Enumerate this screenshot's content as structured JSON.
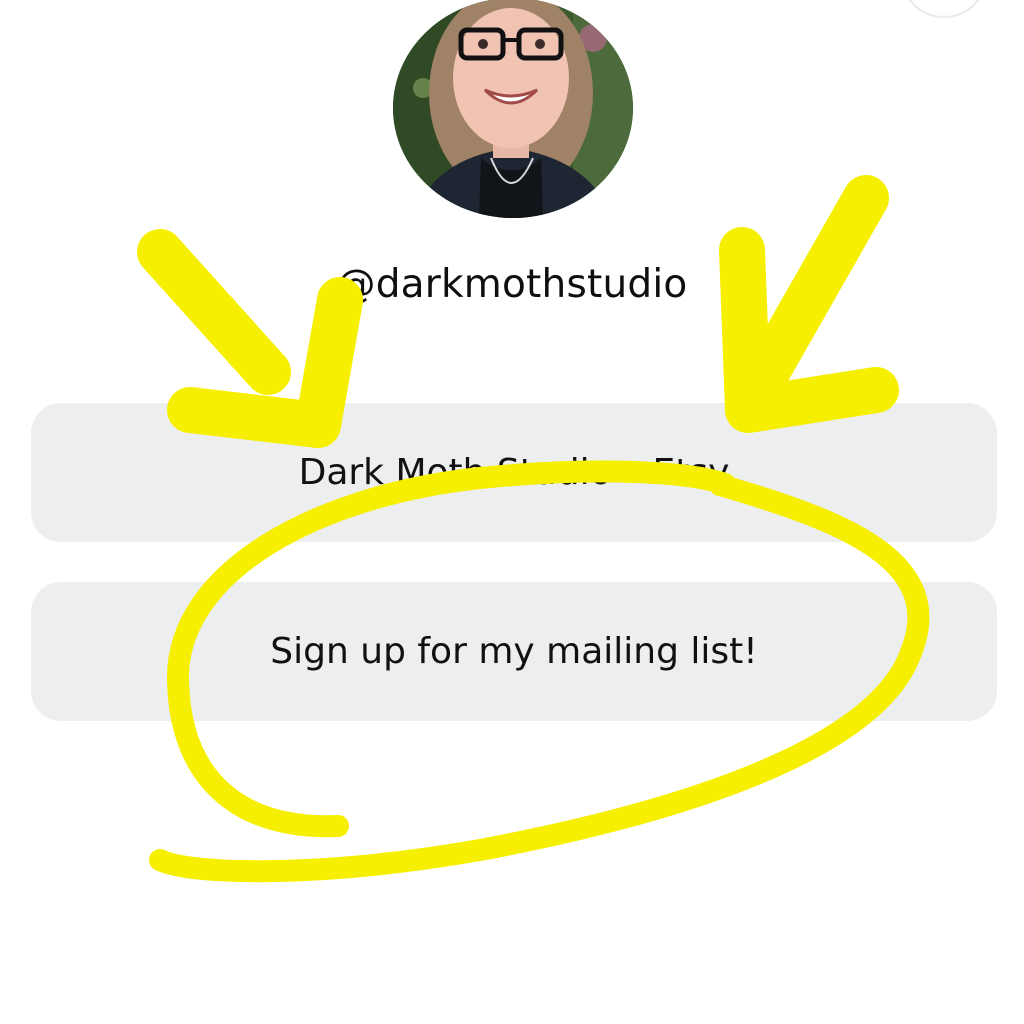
{
  "profile": {
    "handle": "@darkmothstudio",
    "avatar_icon": "profile-photo"
  },
  "links": [
    {
      "label": "Dark Moth Studio – Etsy"
    },
    {
      "label": "Sign up for my mailing list!"
    }
  ],
  "annotation": {
    "color": "#f6f000",
    "icons": [
      "arrow-left-icon",
      "arrow-right-icon",
      "circle-highlight-icon"
    ]
  },
  "colors": {
    "background": "#ffffff",
    "button_bg": "#eceef0",
    "text": "#111111"
  }
}
